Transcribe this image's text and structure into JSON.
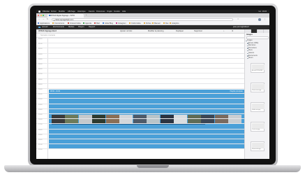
{
  "browser": {
    "menubar": {
      "app": "Chrome",
      "items": [
        "Fichier",
        "Modifier",
        "Affichage",
        "Historique",
        "Favoris",
        "Personnes",
        "Onglet",
        "Fenêtre",
        "Aide"
      ],
      "clock": "lun. 10:24"
    },
    "tab": {
      "title": "ISTKIA Digital Signage - ISTKI"
    },
    "new_tab": "+",
    "url": "istkia.signagehigh.com",
    "bookmarks": [
      "Applications",
      "Concurrents",
      "Intranet Istkia",
      "Agenda",
      "Mail",
      "Istkia Blog",
      "Instagram",
      "Outils Istkia",
      "Fiches",
      "Manuel",
      "Dev",
      "Analytics"
    ]
  },
  "app": {
    "topbar_items": [
      "Accueil",
      "Environments",
      "Médias",
      "Players",
      "Rapport"
    ],
    "topbar_right": "jean.pierre@istkia.fr",
    "title": "ISTKIA Signage Bord",
    "toolbar_items": [
      "Ajouter un bloc",
      "Modifier le planning",
      "Dupliquer",
      "Supprimer"
    ],
    "subbar_text": "Semaine courante",
    "hours": [
      "00:00",
      "01:00",
      "02:00",
      "03:00",
      "04:00",
      "05:00",
      "06:00",
      "07:00",
      "08:00",
      "09:00",
      "10:00",
      "11:00",
      "12:00",
      "13:00",
      "14:00",
      "15:00",
      "16:00",
      "17:00",
      "18:00",
      "19:00",
      "20:00",
      "21:00",
      "22:00"
    ],
    "block": {
      "time": "08:00 - 16:00",
      "label": "Playlist principale"
    },
    "thumb_colors": [
      "#3a3a3a",
      "#6d7a5a",
      "#c5c9cc",
      "#2e3a2e",
      "#8a6e55",
      "#d4d7da",
      "#4e5a68",
      "#b8c4c9",
      "#2c3340",
      "#d9dde0",
      "#5f6b55",
      "#3c4654",
      "#7a6a5e",
      "#c9ced2"
    ],
    "sidebar": {
      "tabs": [
        "Médias",
        "Widgets",
        "Playlists",
        "Modèles"
      ],
      "heading": "Images",
      "items": [
        "Images",
        "Écrans 1080p",
        "Bannières",
        "Promotions",
        "Menu",
        "Saisons",
        "Événements",
        "Divers"
      ],
      "cards": [
        "Accueil 1920x1080",
        "Promo menu.jpg",
        "Soldes ete.png",
        "Carte vins.jpg",
        "Nouveautes.jpg"
      ]
    },
    "colors": {
      "block": "#4aa0d8",
      "topbar": "#2b2b2b"
    }
  }
}
